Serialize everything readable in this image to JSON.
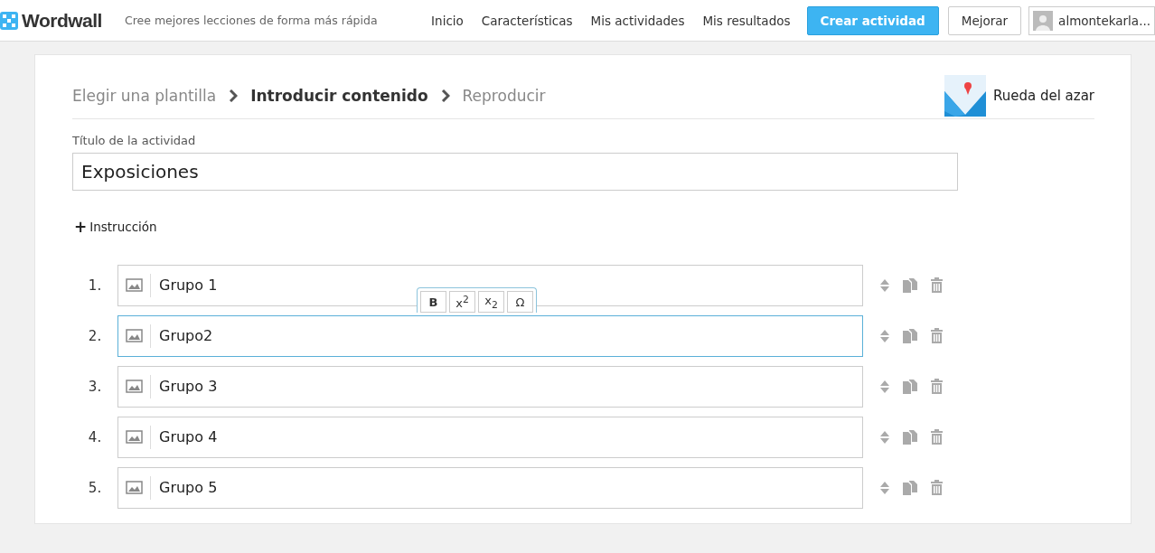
{
  "header": {
    "brand": "Wordwall",
    "tagline": "Cree mejores lecciones de forma más rápida",
    "nav": [
      {
        "label": "Inicio"
      },
      {
        "label": "Características"
      },
      {
        "label": "Mis actividades"
      },
      {
        "label": "Mis resultados"
      }
    ],
    "create_button": "Crear actividad",
    "upgrade_button": "Mejorar",
    "user": "almontekarla..."
  },
  "steps": [
    {
      "label": "Elegir una plantilla",
      "selected": false
    },
    {
      "label": "Introducir contenido",
      "selected": true
    },
    {
      "label": "Reproducir",
      "selected": false
    }
  ],
  "template": {
    "name": "Rueda del azar"
  },
  "activity_title": {
    "label": "Título de la actividad",
    "value": "Exposiciones"
  },
  "instruction_button": {
    "icon": "+",
    "label": "Instrucción"
  },
  "format_toolbar": [
    "B",
    "x$^{2}$",
    "x$_{2}$",
    "Ω"
  ],
  "items": [
    {
      "number": "1.",
      "value": "Grupo 1",
      "selected": false
    },
    {
      "number": "2.",
      "value": "Grupo2",
      "selected": true
    },
    {
      "number": "3.",
      "value": "Grupo 3",
      "selected": false
    },
    {
      "number": "4.",
      "value": "Grupo 4",
      "selected": false
    },
    {
      "number": "5.",
      "value": "Grupo 5",
      "selected": false
    }
  ]
}
